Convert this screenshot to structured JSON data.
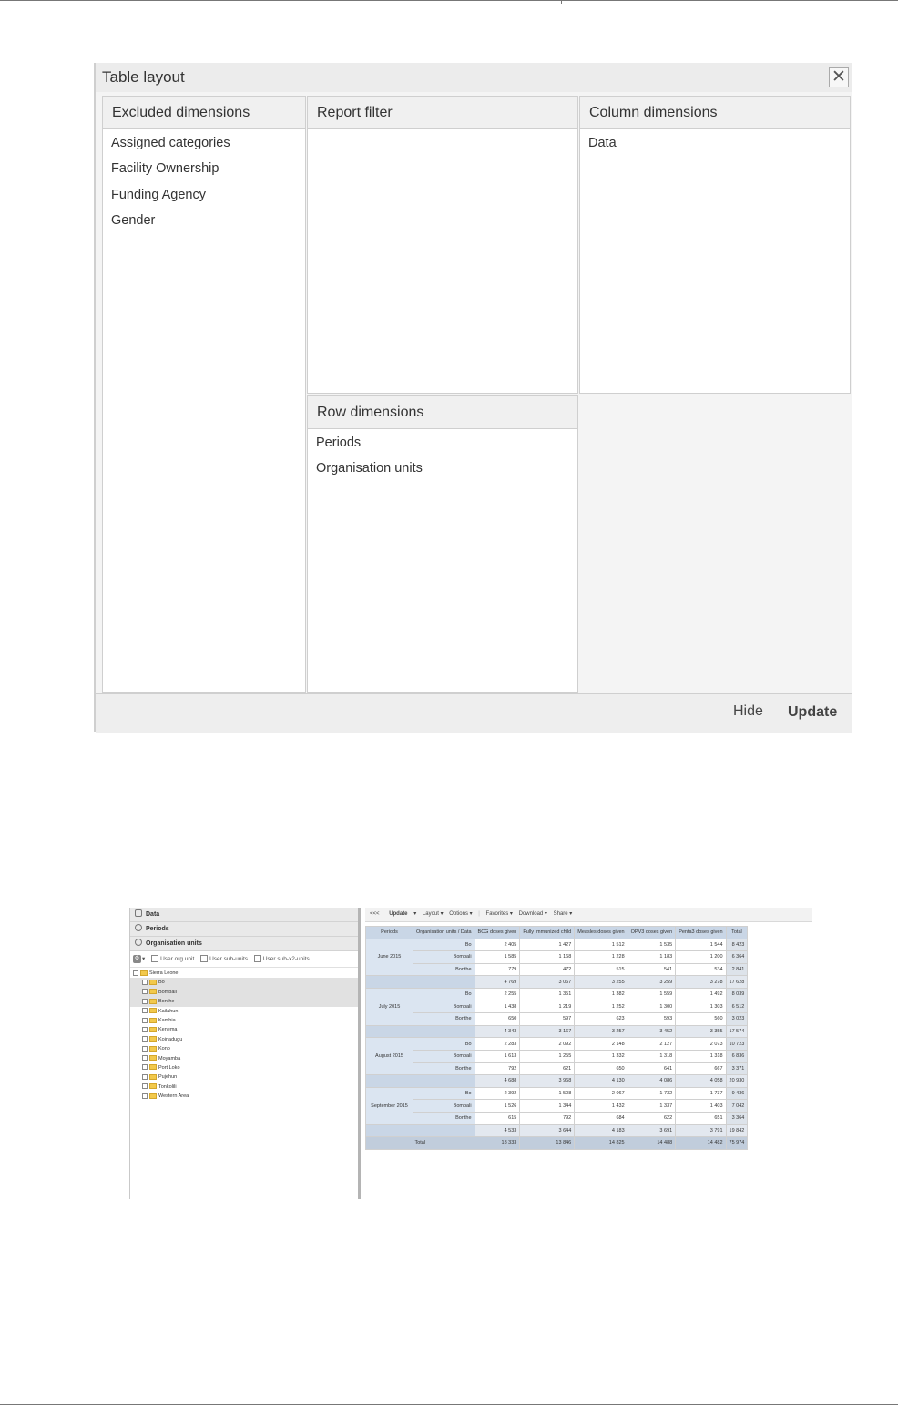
{
  "dialog": {
    "title": "Table layout",
    "close_label": "✕",
    "panels": {
      "excluded": {
        "title": "Excluded dimensions",
        "items": [
          "Assigned categories",
          "Facility Ownership",
          "Funding Agency",
          "Gender"
        ]
      },
      "filter": {
        "title": "Report filter",
        "items": []
      },
      "columns": {
        "title": "Column dimensions",
        "items": [
          "Data"
        ]
      },
      "rows": {
        "title": "Row dimensions",
        "items": [
          "Periods",
          "Organisation units"
        ]
      }
    },
    "footer": {
      "hide_label": "Hide",
      "update_label": "Update"
    }
  },
  "screenshot": {
    "sidebar": {
      "sections": [
        "Data",
        "Periods",
        "Organisation units"
      ],
      "toolbar": {
        "user_org_unit": "User org unit",
        "user_sub_units": "User sub-units",
        "user_sub_x2_units": "User sub-x2-units"
      },
      "tree": [
        {
          "label": "Sierra Leone",
          "level": 0,
          "selected": false
        },
        {
          "label": "Bo",
          "level": 1,
          "selected": true
        },
        {
          "label": "Bombali",
          "level": 1,
          "selected": true
        },
        {
          "label": "Bonthe",
          "level": 1,
          "selected": true
        },
        {
          "label": "Kailahun",
          "level": 1,
          "selected": false
        },
        {
          "label": "Kambia",
          "level": 1,
          "selected": false
        },
        {
          "label": "Kenema",
          "level": 1,
          "selected": false
        },
        {
          "label": "Koinadugu",
          "level": 1,
          "selected": false
        },
        {
          "label": "Kono",
          "level": 1,
          "selected": false
        },
        {
          "label": "Moyamba",
          "level": 1,
          "selected": false
        },
        {
          "label": "Port Loko",
          "level": 1,
          "selected": false
        },
        {
          "label": "Pujehun",
          "level": 1,
          "selected": false
        },
        {
          "label": "Tonkolili",
          "level": 1,
          "selected": false
        },
        {
          "label": "Western Area",
          "level": 1,
          "selected": false
        }
      ]
    },
    "toolbar": {
      "collapse": "<<<",
      "update": "Update",
      "update_arrow": "▾",
      "layout": "Layout ▾",
      "options": "Options ▾",
      "favorites": "Favorites ▾",
      "download": "Download ▾",
      "share": "Share ▾"
    },
    "table": {
      "headers": [
        "Periods",
        "Organisation units / Data",
        "BCG doses given",
        "Fully Immunized child",
        "Measles doses given",
        "OPV3 doses given",
        "Penta3 doses given",
        "Total"
      ],
      "groups": [
        {
          "period": "June 2015",
          "rows": [
            {
              "unit": "Bo",
              "values": [
                "2 405",
                "1 427",
                "1 512",
                "1 535",
                "1 544",
                "8 423"
              ]
            },
            {
              "unit": "Bombali",
              "values": [
                "1 585",
                "1 168",
                "1 228",
                "1 183",
                "1 200",
                "6 364"
              ]
            },
            {
              "unit": "Bonthe",
              "values": [
                "779",
                "472",
                "515",
                "541",
                "534",
                "2 841"
              ]
            }
          ],
          "subtotal": [
            "4 769",
            "3 067",
            "3 255",
            "3 259",
            "3 278",
            "17 628"
          ]
        },
        {
          "period": "July 2015",
          "rows": [
            {
              "unit": "Bo",
              "values": [
                "2 255",
                "1 351",
                "1 382",
                "1 559",
                "1 492",
                "8 039"
              ]
            },
            {
              "unit": "Bombali",
              "values": [
                "1 438",
                "1 219",
                "1 252",
                "1 300",
                "1 303",
                "6 512"
              ]
            },
            {
              "unit": "Bonthe",
              "values": [
                "650",
                "597",
                "623",
                "593",
                "560",
                "3 023"
              ]
            }
          ],
          "subtotal": [
            "4 343",
            "3 167",
            "3 257",
            "3 452",
            "3 355",
            "17 574"
          ]
        },
        {
          "period": "August 2015",
          "rows": [
            {
              "unit": "Bo",
              "values": [
                "2 283",
                "2 092",
                "2 148",
                "2 127",
                "2 073",
                "10 723"
              ]
            },
            {
              "unit": "Bombali",
              "values": [
                "1 613",
                "1 255",
                "1 332",
                "1 318",
                "1 318",
                "6 836"
              ]
            },
            {
              "unit": "Bonthe",
              "values": [
                "792",
                "621",
                "650",
                "641",
                "667",
                "3 371"
              ]
            }
          ],
          "subtotal": [
            "4 688",
            "3 968",
            "4 130",
            "4 086",
            "4 058",
            "20 930"
          ]
        },
        {
          "period": "September 2015",
          "rows": [
            {
              "unit": "Bo",
              "values": [
                "2 392",
                "1 508",
                "2 067",
                "1 732",
                "1 737",
                "9 436"
              ]
            },
            {
              "unit": "Bombali",
              "values": [
                "1 526",
                "1 344",
                "1 432",
                "1 337",
                "1 403",
                "7 042"
              ]
            },
            {
              "unit": "Bonthe",
              "values": [
                "615",
                "792",
                "684",
                "622",
                "651",
                "3 364"
              ]
            }
          ],
          "subtotal": [
            "4 533",
            "3 644",
            "4 183",
            "3 691",
            "3 791",
            "19 842"
          ]
        }
      ],
      "total_label": "Total",
      "total_values": [
        "18 333",
        "13 846",
        "14 825",
        "14 488",
        "14 482",
        "75 974"
      ]
    }
  }
}
